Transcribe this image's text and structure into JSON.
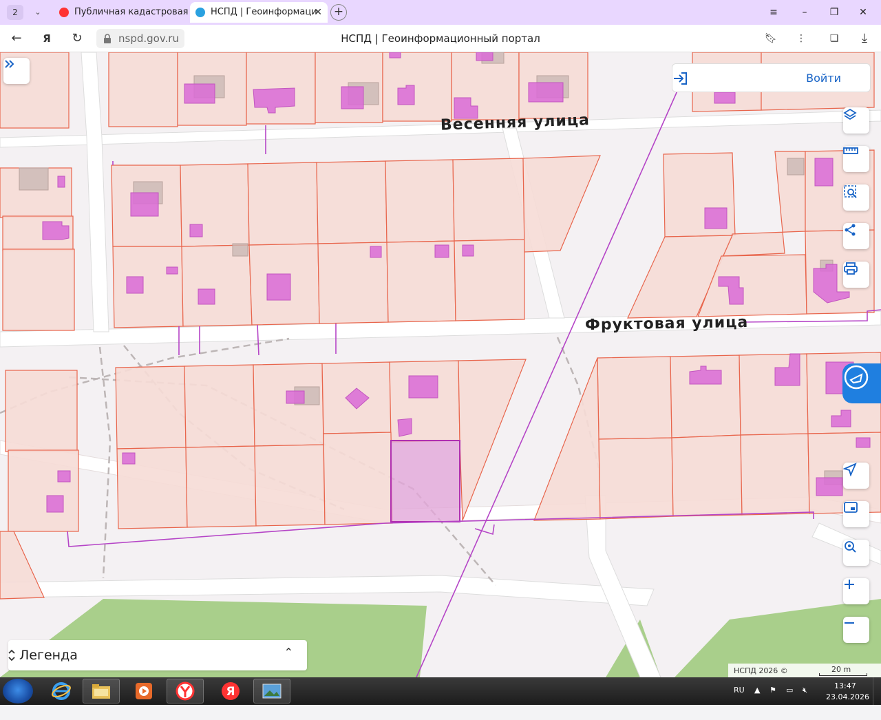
{
  "browser": {
    "tab_count": "2",
    "tabs": [
      {
        "title": "Публичная кадастровая к",
        "active": false
      },
      {
        "title": "НСПД | Геоинформаци",
        "active": true
      }
    ],
    "new_tab": "+",
    "url": "nspd.gov.ru",
    "page_title": "НСПД | Геоинформационный портал"
  },
  "map": {
    "streets": [
      "Весенняя улица",
      "Фруктовая улица"
    ],
    "login_label": "Войти",
    "legend_label": "Легенда",
    "copyright": "НСПД 2026 ©",
    "scale_label": "20 m",
    "colors": {
      "parcel_fill": "#f6dcd6",
      "parcel_stroke": "#e8654c",
      "building": "#d96bd6",
      "selected": "#b030b0",
      "road": "#ffffff",
      "green": "#a9cf8b",
      "accent": "#1763c6"
    },
    "controls": [
      "expand-icon",
      "layers-icon",
      "ruler-icon",
      "area-search-icon",
      "share-icon",
      "print-icon",
      "navigate-icon",
      "minimap-icon",
      "geo-search-icon",
      "zoom-in-icon",
      "zoom-out-icon"
    ]
  },
  "taskbar": {
    "language": "RU",
    "time": "13:47",
    "date": "23.04.2026"
  }
}
